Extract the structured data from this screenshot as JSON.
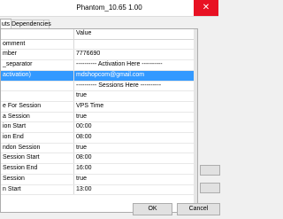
{
  "window": {
    "title": "Phantom_10.65 1.00",
    "close_label": "✕"
  },
  "tabs": [
    {
      "label": "uts"
    },
    {
      "label": "Dependencies"
    }
  ],
  "grid": {
    "header": {
      "value": "Value"
    },
    "rows": [
      {
        "name": "omment",
        "value": ""
      },
      {
        "name": "mber",
        "value": "7776690"
      },
      {
        "name": "_separator",
        "value": "---------- Activation Here ----------"
      },
      {
        "name": "activation)",
        "value": "mdshopcom@gmail.com"
      },
      {
        "name": "",
        "value": "---------- Sessions Here ----------"
      },
      {
        "name": "",
        "value": "true"
      },
      {
        "name": "e For Session",
        "value": "VPS Time"
      },
      {
        "name": "a Session",
        "value": "true"
      },
      {
        "name": "ion Start",
        "value": "00:00"
      },
      {
        "name": "ion End",
        "value": "08:00"
      },
      {
        "name": "ndon Session",
        "value": "true"
      },
      {
        "name": "Session Start",
        "value": "08:00"
      },
      {
        "name": "Session End",
        "value": "16:00"
      },
      {
        "name": "Session",
        "value": "true"
      },
      {
        "name": "n Start",
        "value": "13:00"
      }
    ]
  },
  "buttons": {
    "ok": "OK",
    "cancel": "Cancel"
  }
}
